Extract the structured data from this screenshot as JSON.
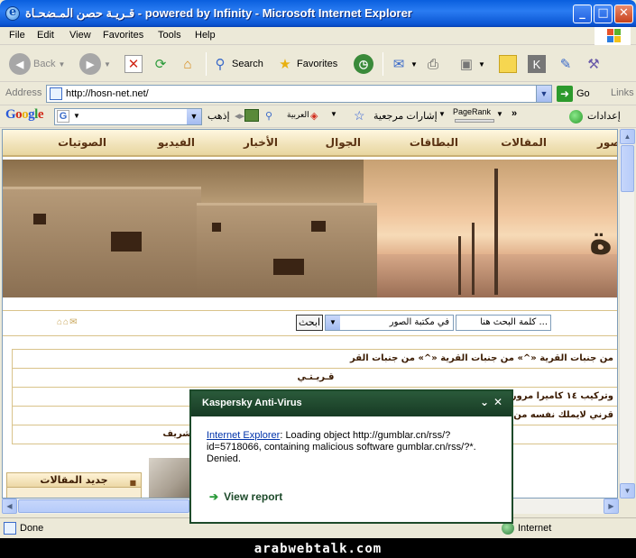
{
  "window": {
    "title": "قـريـة حصن المـضحـاة - powered by Infinity - Microsoft Internet Explorer",
    "controls": [
      "_",
      "□",
      "✕"
    ]
  },
  "menu": [
    "File",
    "Edit",
    "View",
    "Favorites",
    "Tools",
    "Help"
  ],
  "toolbar": {
    "back": "Back",
    "search": "Search",
    "favorites": "Favorites"
  },
  "address": {
    "label": "Address",
    "url": "http://hosn-net.net/",
    "go": "Go",
    "links": "Links"
  },
  "googlebar": {
    "logo": "Google",
    "search_letter": "G",
    "go_label": "إذهب",
    "arabic": "العربية",
    "bookmarks": "إشارات مرجعية",
    "pagerank": "PageRank",
    "more": "»",
    "settings": "إعدادات"
  },
  "site": {
    "nav": [
      "صور",
      "المقالات",
      "البطاقات",
      "الجوال",
      "الأخبار",
      "الفيديو",
      "الصوتيات"
    ],
    "banner_letter": "ة",
    "search_button": "ابحث",
    "search_scope": "في مكتبة الصور",
    "search_placeholder": "... كلمة البحث هنا",
    "news": [
      "من جنبات القرية «^» من جنبات القرية «^» من جنبات القر",
      "قـريـتـي",
      "وتركيب ١٤ كاميرا مرور بالباحة «^» يغضي",
      "قرني لايملك نفسه من الضحك وهو على الهو",
      "بل «^» عبدالله الشريف"
    ],
    "side_header": "جديد المقالات"
  },
  "status": {
    "text": "Done",
    "zone": "Internet"
  },
  "popup": {
    "title": "Kaspersky Anti-Virus",
    "minimize": "⌄",
    "close": "✕",
    "link": "Internet Explorer",
    "message": ": Loading object http://gumblar.cn/rss/?id=5718066, containing malicious software gumblar.cn/rss/?*.",
    "result": "Denied.",
    "view_report": "View report"
  },
  "footer": "arabwebtalk.com"
}
